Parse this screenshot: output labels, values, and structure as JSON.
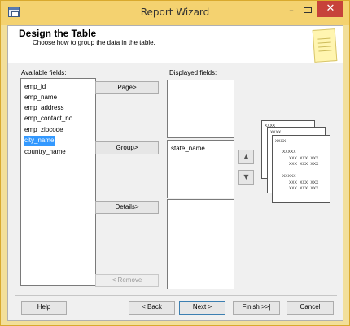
{
  "window": {
    "title": "Report Wizard",
    "minimize_glyph": "–",
    "close_glyph": "✕"
  },
  "header": {
    "title": "Design the Table",
    "subtitle": "Choose how to group the data in the table."
  },
  "available": {
    "label": "Available fields:",
    "items": [
      "emp_id",
      "emp_name",
      "emp_address",
      "emp_contact_no",
      "emp_zipcode",
      "city_name",
      "country_name"
    ],
    "selected_index": 5
  },
  "buttons_mid": {
    "page": "Page>",
    "group": "Group>",
    "details": "Details>",
    "remove": "< Remove"
  },
  "displayed": {
    "label": "Displayed fields:",
    "page_items": [],
    "group_items": [
      "state_name"
    ],
    "details_items": []
  },
  "order": {
    "up_glyph": "▲",
    "down_glyph": "▼"
  },
  "preview": {
    "lines": [
      "XXXX",
      "XXXX",
      "XXXX",
      "XXXXX",
      "XXX XXX XXX",
      "XXX XXX XXX",
      "XXXXX",
      "XXX XXX XXX",
      "XXX XXX XXX"
    ]
  },
  "footer": {
    "help": "Help",
    "back": "< Back",
    "next": "Next >",
    "finish": "Finish >>|",
    "cancel": "Cancel"
  },
  "colors": {
    "titlebar": "#f4d270",
    "close": "#c7423a",
    "selection": "#3399ff"
  }
}
